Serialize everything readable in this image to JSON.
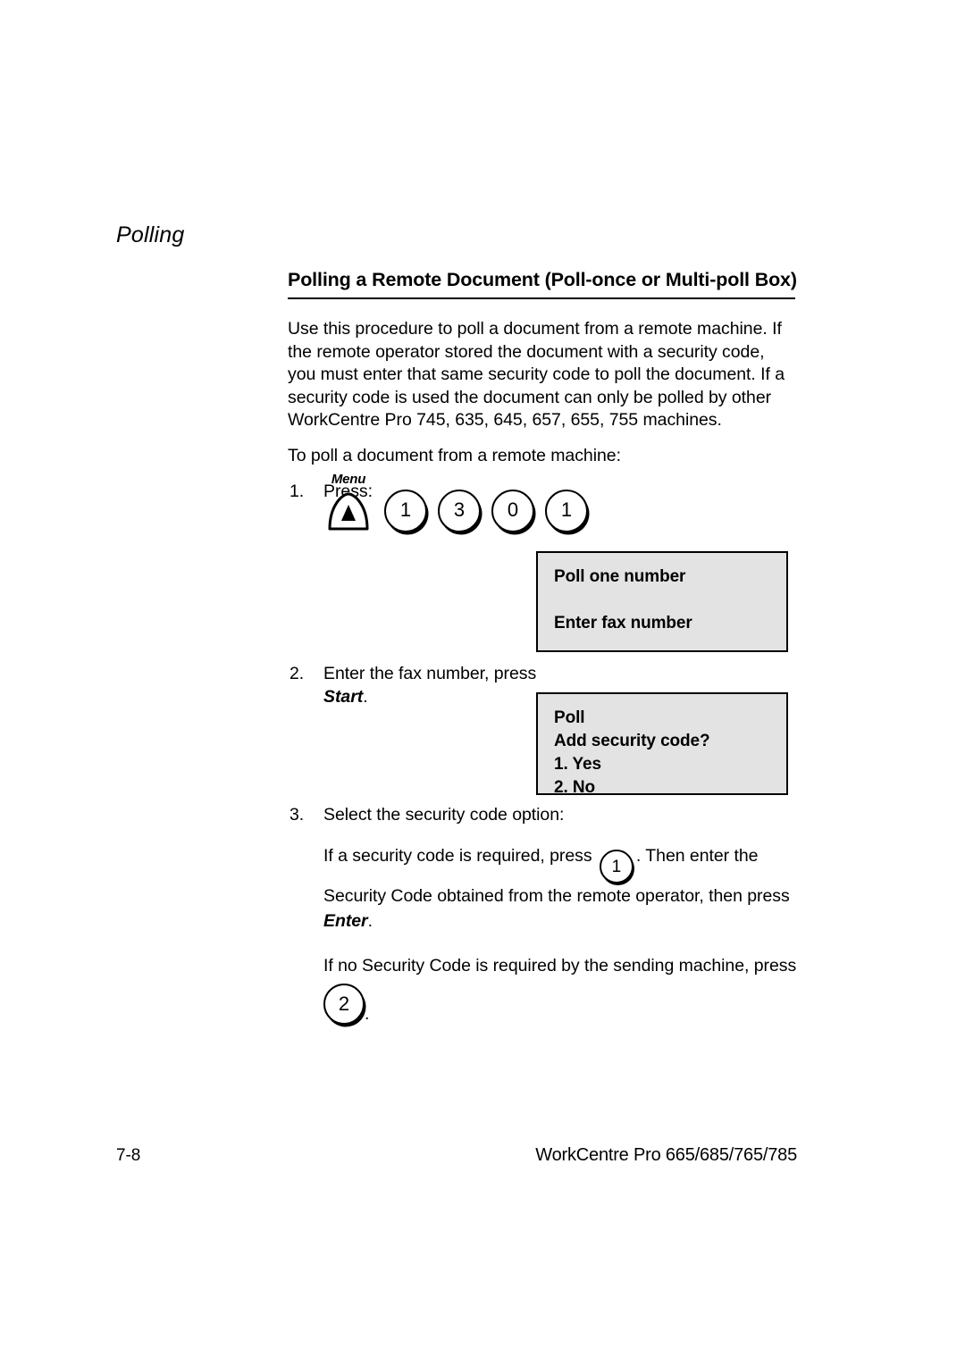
{
  "page": {
    "running_head": "Polling",
    "heading": "Polling a Remote Document (Poll-once or Multi-poll Box)"
  },
  "intro": {
    "paragraph_1": "Use this procedure to poll a document from a remote machine. If the remote operator stored the document with a security code, you must enter that same security code to poll the document. If a security code is used the document can only be polled by other WorkCentre Pro 745, 635, 645, 657, 655, 755 machines.",
    "paragraph_2": "To poll a document from a remote machine:"
  },
  "steps": [
    {
      "number": "1.",
      "text": "Press:"
    },
    {
      "number": "2.",
      "text_before": "Enter the fax number, press ",
      "emphasis": "Start",
      "text_after": "."
    },
    {
      "number": "3.",
      "text": "Select the security code option:"
    }
  ],
  "key_sequence": {
    "menu_key": {
      "label": "Menu",
      "icon": "menu-dome-triangle-icon"
    },
    "number_keys": [
      "1",
      "3",
      "0",
      "1"
    ]
  },
  "lcd_displays": [
    {
      "id": "poll-one-number",
      "lines": [
        "Poll one number",
        "",
        "Enter fax number"
      ]
    },
    {
      "id": "add-security-code",
      "lines": [
        "Poll",
        "Add security code?",
        "1. Yes",
        "2. No"
      ]
    }
  ],
  "security_option_yes": {
    "text_before": "If a security code is required, press ",
    "key": "1",
    "text_middle": ". Then enter the Security Code obtained from the remote operator, then press ",
    "emphasis": "Enter",
    "text_after": "."
  },
  "security_option_no": {
    "text": "If no Security Code is required by the sending machine, press",
    "key": "2",
    "trailing": "."
  },
  "footer": {
    "page_number": "7-8",
    "product": "WorkCentre Pro 665/685/765/785"
  },
  "colors": {
    "lcd_background": "#e3e3e3",
    "ink": "#000000",
    "paper": "#ffffff"
  }
}
